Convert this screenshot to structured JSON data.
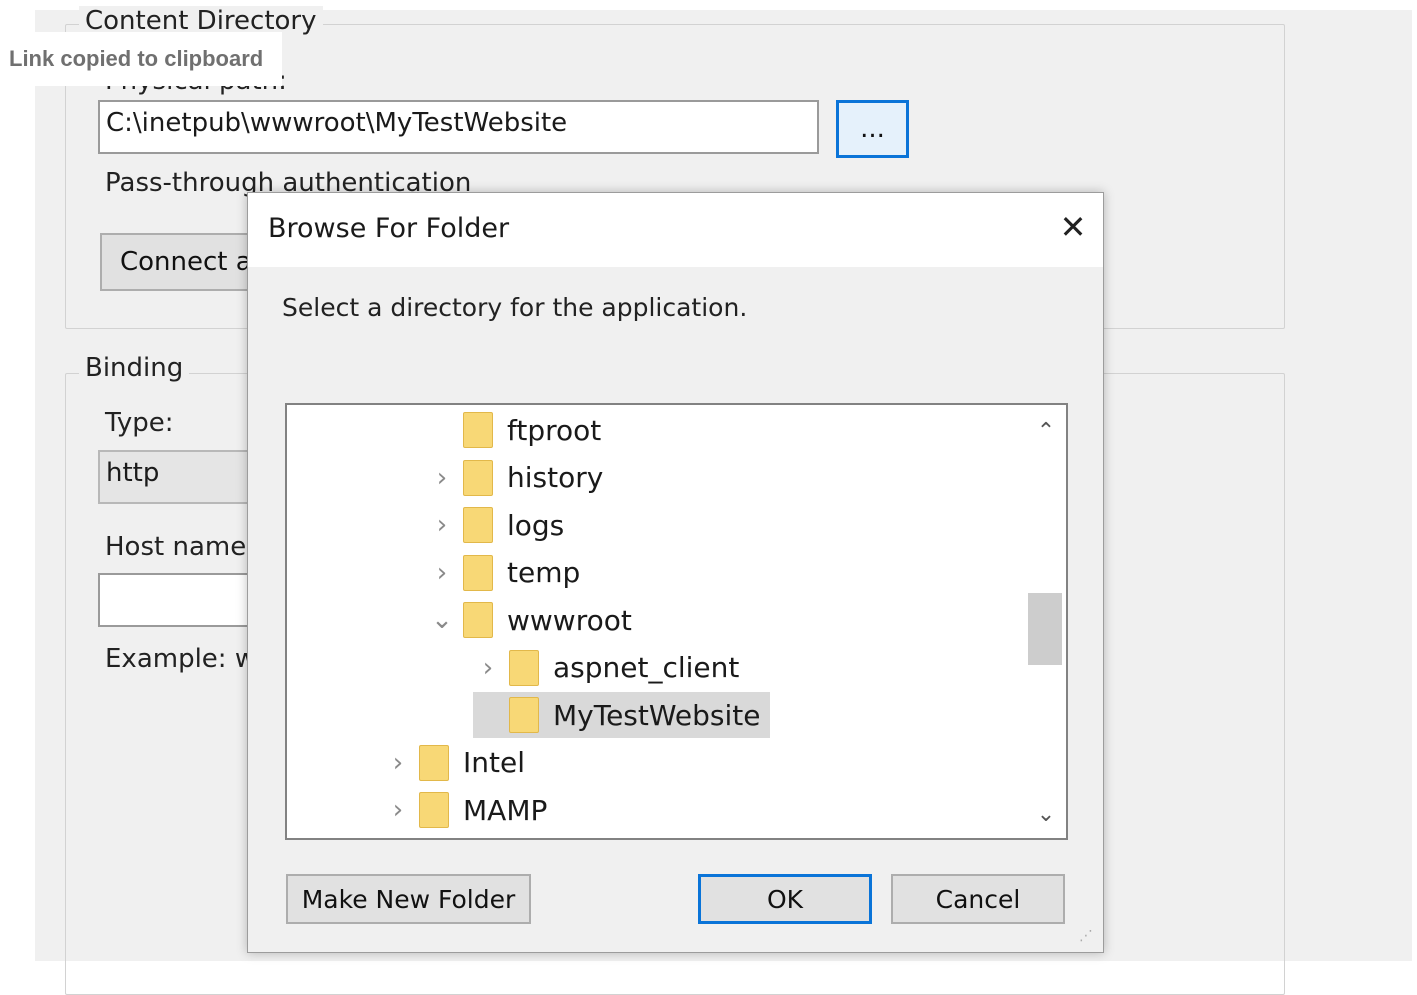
{
  "toast": {
    "text": "Link copied to clipboard"
  },
  "background": {
    "content_directory": {
      "label": "Content Directory",
      "physical_path_label": "Physical path:",
      "physical_path_value": "C:\\inetpub\\wwwroot\\MyTestWebsite",
      "browse_button": "...",
      "pass_through_label": "Pass-through authentication",
      "connect_as_button": "Connect as..."
    },
    "binding": {
      "label": "Binding",
      "type_label": "Type:",
      "type_value": "http",
      "host_name_label": "Host name:",
      "host_name_value": "",
      "example_label": "Example: w"
    }
  },
  "dialog": {
    "title": "Browse For Folder",
    "close_glyph": "✕",
    "instruction": "Select a directory for the application.",
    "tree": [
      {
        "label": "ftproot",
        "level": 2,
        "expander": "",
        "selected": false
      },
      {
        "label": "history",
        "level": 2,
        "expander": "›",
        "selected": false
      },
      {
        "label": "logs",
        "level": 2,
        "expander": "›",
        "selected": false
      },
      {
        "label": "temp",
        "level": 2,
        "expander": "›",
        "selected": false
      },
      {
        "label": "wwwroot",
        "level": 2,
        "expander": "⌄",
        "selected": false
      },
      {
        "label": "aspnet_client",
        "level": 3,
        "expander": "›",
        "selected": false
      },
      {
        "label": "MyTestWebsite",
        "level": 3,
        "expander": "",
        "selected": true
      },
      {
        "label": "Intel",
        "level": 1,
        "expander": "›",
        "selected": false
      },
      {
        "label": "MAMP",
        "level": 1,
        "expander": "›",
        "selected": false
      }
    ],
    "scroll_up_glyph": "⌃",
    "scroll_down_glyph": "⌄",
    "make_new_folder_button": "Make New Folder",
    "ok_button": "OK",
    "cancel_button": "Cancel"
  },
  "colors": {
    "dialog_background": "#f0f0f0",
    "focus_border": "#0a74d8",
    "folder_icon": "#f8d876",
    "selection": "#d9d9d9"
  }
}
